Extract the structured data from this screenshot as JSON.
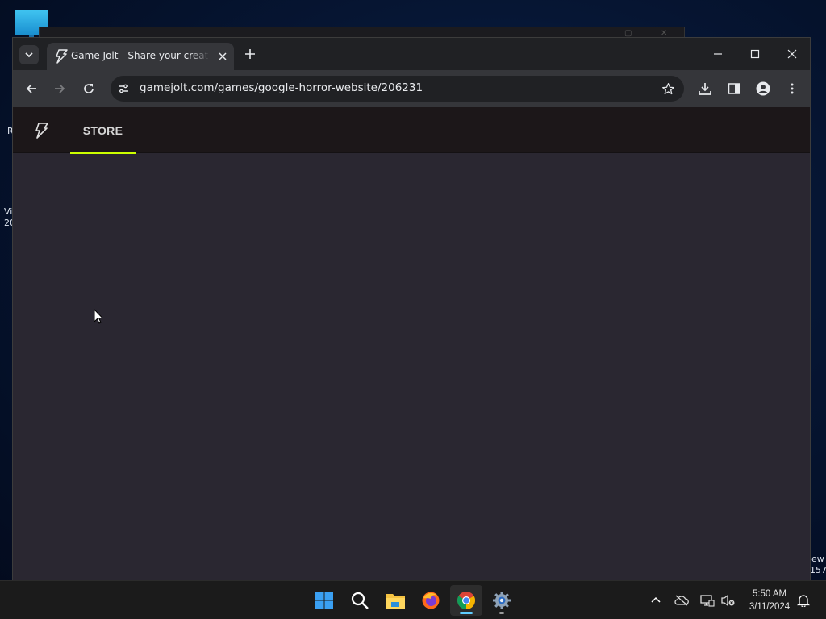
{
  "desktop": {
    "labels": [
      "R",
      "Vi",
      "20",
      "ew",
      "157"
    ]
  },
  "browser": {
    "tab": {
      "title": "Game Jolt - Share your creations",
      "favicon": "gamejolt-bolt-icon"
    },
    "toolbar": {
      "url": "gamejolt.com/games/google-horror-website/206231"
    }
  },
  "site": {
    "nav": {
      "store_label": "STORE"
    },
    "colors": {
      "accent": "#ccff00",
      "nav_bg": "#1c1719",
      "content_bg": "#2a2731"
    }
  },
  "taskbar": {
    "time": "5:50 AM",
    "date": "3/11/2024",
    "apps": [
      "start-icon",
      "search-icon",
      "file-explorer-icon",
      "firefox-icon",
      "chrome-icon",
      "settings-icon"
    ]
  }
}
